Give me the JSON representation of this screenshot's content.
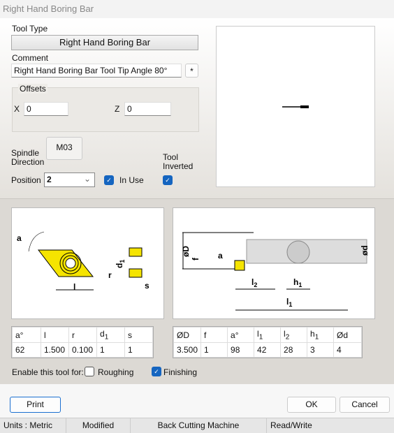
{
  "window": {
    "title": "Right Hand Boring Bar"
  },
  "tool_type": {
    "label": "Tool Type",
    "value": "Right Hand Boring Bar"
  },
  "comment": {
    "label": "Comment",
    "value": "Right Hand Boring Bar Tool Tip Angle 80°",
    "star_button": "*"
  },
  "offsets": {
    "label": "Offsets",
    "x_label": "X",
    "x_value": "0",
    "z_label": "Z",
    "z_value": "0"
  },
  "spindle": {
    "label_line1": "Spindle",
    "label_line2": "Direction",
    "value": "M03"
  },
  "position": {
    "label": "Position",
    "value": "2"
  },
  "in_use": {
    "label": "In Use",
    "checked": true
  },
  "tool_inverted": {
    "label_line1": "Tool",
    "label_line2": "Inverted",
    "checked": true
  },
  "insert_diagram": {
    "labels": {
      "a": "a",
      "r": "r",
      "d1": "d",
      "d1_sub": "1",
      "l": "l",
      "s": "s"
    },
    "insert_color": "#f5e400"
  },
  "bar_diagram": {
    "labels": {
      "D": "øD",
      "f": "f",
      "a": "a",
      "l2": "l",
      "l2_sub": "2",
      "h1": "h",
      "h1_sub": "1",
      "l1": "l",
      "l1_sub": "1",
      "d": "ød"
    }
  },
  "insert_table": {
    "headers": [
      {
        "t": "a°",
        "s": ""
      },
      {
        "t": "l",
        "s": ""
      },
      {
        "t": "r",
        "s": ""
      },
      {
        "t": "d",
        "s": "1"
      },
      {
        "t": "s",
        "s": ""
      }
    ],
    "values": [
      "62",
      "1.500",
      "0.100",
      "1",
      "1"
    ]
  },
  "bar_table": {
    "headers": [
      {
        "t": "ØD",
        "s": ""
      },
      {
        "t": "f",
        "s": ""
      },
      {
        "t": "a°",
        "s": ""
      },
      {
        "t": "l",
        "s": "1"
      },
      {
        "t": "l",
        "s": "2"
      },
      {
        "t": "h",
        "s": "1"
      },
      {
        "t": "Ød",
        "s": ""
      }
    ],
    "values": [
      "3.500",
      "1",
      "98",
      "42",
      "28",
      "3",
      "4"
    ]
  },
  "enable": {
    "label": "Enable this tool for:",
    "roughing": {
      "label": "Roughing",
      "checked": false
    },
    "finishing": {
      "label": "Finishing",
      "checked": true
    }
  },
  "buttons": {
    "print": "Print",
    "ok": "OK",
    "cancel": "Cancel"
  },
  "status": {
    "units": "Units : Metric",
    "modified": "Modified",
    "machine": "Back Cutting Machine",
    "access": "Read/Write"
  }
}
